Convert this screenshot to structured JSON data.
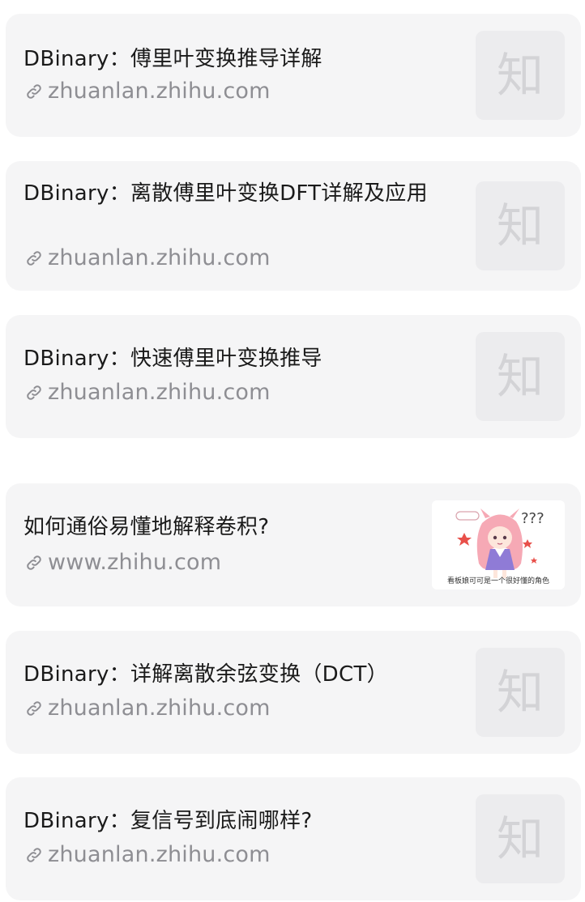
{
  "cards": [
    {
      "title": "DBinary：傅里叶变换推导详解",
      "domain": "zhuanlan.zhihu.com",
      "thumb_glyph": "知",
      "thumb_type": "zhihu-logo"
    },
    {
      "title": "DBinary：离散傅里叶变换DFT详解及应用",
      "domain": "zhuanlan.zhihu.com",
      "thumb_glyph": "知",
      "thumb_type": "zhihu-logo"
    },
    {
      "title": "DBinary：快速傅里叶变换推导",
      "domain": "zhuanlan.zhihu.com",
      "thumb_glyph": "知",
      "thumb_type": "zhihu-logo"
    },
    {
      "title": "如何通俗易懂地解释卷积?",
      "domain": "www.zhihu.com",
      "thumb_type": "anime-illustration",
      "thumb_caption": "看板娘可可是一个很好懂的角色",
      "thumb_bubble": "???"
    },
    {
      "title": "DBinary：详解离散余弦变换（DCT）",
      "domain": "zhuanlan.zhihu.com",
      "thumb_glyph": "知",
      "thumb_type": "zhihu-logo"
    },
    {
      "title": "DBinary：复信号到底闹哪样?",
      "domain": "zhuanlan.zhihu.com",
      "thumb_glyph": "知",
      "thumb_type": "zhihu-logo"
    }
  ],
  "colors": {
    "card_bg": "#f5f5f6",
    "title": "#1a1a1a",
    "domain": "#8e8e93",
    "thumb_bg": "#ececee"
  }
}
